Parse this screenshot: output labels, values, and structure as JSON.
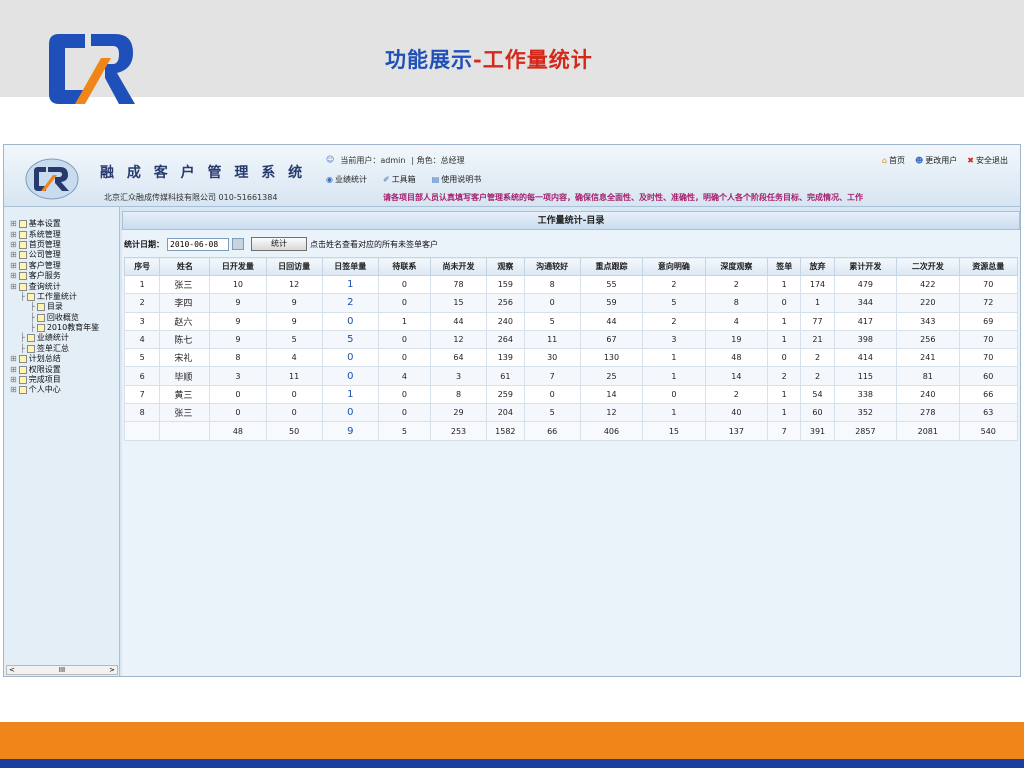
{
  "slide": {
    "title_prefix": "功能展示",
    "title_dash": "-",
    "title_accent": "工作量统计"
  },
  "app": {
    "name": "融 成 客 户 管 理 系 统",
    "company": "北京汇众融成传媒科技有限公司  010-51661384",
    "current_user_label": "当前用户：admin",
    "role_label": "| 角色：总经理",
    "toolbar": [
      "业绩统计",
      "工具箱",
      "使用说明书"
    ],
    "top_links": [
      "首页",
      "更改用户",
      "安全退出"
    ],
    "marquee": "请各项目部人员认真填写客户管理系统的每一项内容，确保信息全面性、及时性、准确性，明确个人各个阶段任务目标、完成情况、工作"
  },
  "sidebar": {
    "items": [
      {
        "label": "基本设置",
        "indent": 0
      },
      {
        "label": "系统管理",
        "indent": 0
      },
      {
        "label": "首页管理",
        "indent": 0
      },
      {
        "label": "公司管理",
        "indent": 0
      },
      {
        "label": "客户管理",
        "indent": 0
      },
      {
        "label": "客户服务",
        "indent": 0
      },
      {
        "label": "查询统计",
        "indent": 0
      },
      {
        "label": "工作量统计",
        "indent": 1
      },
      {
        "label": "目录",
        "indent": 2
      },
      {
        "label": "回收概览",
        "indent": 2
      },
      {
        "label": "2010教育年鉴",
        "indent": 2
      },
      {
        "label": "业绩统计",
        "indent": 1
      },
      {
        "label": "签单汇总",
        "indent": 1
      },
      {
        "label": "计划总结",
        "indent": 0
      },
      {
        "label": "权限设置",
        "indent": 0
      },
      {
        "label": "完成项目",
        "indent": 0
      },
      {
        "label": "个人中心",
        "indent": 0
      }
    ],
    "scroll_left": "<",
    "scroll_mid": "III",
    "scroll_right": ">"
  },
  "main": {
    "panel_title": "工作量统计-目录",
    "filter_label": "统计日期：",
    "date_value": "2010-06-08",
    "stat_button": "统计",
    "hint": "点击姓名查看对应的所有未签单客户",
    "columns": [
      "序号",
      "姓名",
      "日开发量",
      "日回访量",
      "日签单量",
      "待联系",
      "尚未开发",
      "观察",
      "沟通较好",
      "重点跟踪",
      "意向明确",
      "深度观察",
      "签单",
      "放弃",
      "累计开发",
      "二次开发",
      "资源总量"
    ],
    "rows": [
      [
        "1",
        "张三",
        "10",
        "12",
        "1",
        "0",
        "78",
        "159",
        "8",
        "55",
        "2",
        "2",
        "1",
        "174",
        "479",
        "422",
        "70"
      ],
      [
        "2",
        "李四",
        "9",
        "9",
        "2",
        "0",
        "15",
        "256",
        "0",
        "59",
        "5",
        "8",
        "0",
        "1",
        "344",
        "220",
        "72"
      ],
      [
        "3",
        "赵六",
        "9",
        "9",
        "0",
        "1",
        "44",
        "240",
        "5",
        "44",
        "2",
        "4",
        "1",
        "77",
        "417",
        "343",
        "69"
      ],
      [
        "4",
        "陈七",
        "9",
        "5",
        "5",
        "0",
        "12",
        "264",
        "11",
        "67",
        "3",
        "19",
        "1",
        "21",
        "398",
        "256",
        "70"
      ],
      [
        "5",
        "宋礼",
        "8",
        "4",
        "0",
        "0",
        "64",
        "139",
        "30",
        "130",
        "1",
        "48",
        "0",
        "2",
        "414",
        "241",
        "70"
      ],
      [
        "6",
        "毕顺",
        "3",
        "11",
        "0",
        "4",
        "3",
        "61",
        "7",
        "25",
        "1",
        "14",
        "2",
        "2",
        "115",
        "81",
        "60"
      ],
      [
        "7",
        "黄三",
        "0",
        "0",
        "1",
        "0",
        "8",
        "259",
        "0",
        "14",
        "0",
        "2",
        "1",
        "54",
        "338",
        "240",
        "66"
      ],
      [
        "8",
        "张三",
        "0",
        "0",
        "0",
        "0",
        "29",
        "204",
        "5",
        "12",
        "1",
        "40",
        "1",
        "60",
        "352",
        "278",
        "63"
      ]
    ],
    "totals": [
      "",
      "",
      "48",
      "50",
      "9",
      "5",
      "253",
      "1582",
      "66",
      "406",
      "15",
      "137",
      "7",
      "391",
      "2857",
      "2081",
      "540"
    ]
  },
  "colors": {
    "title_blue": "#1f4fb8",
    "title_red": "#d4281a",
    "bar_orange": "#f08619",
    "bar_blue": "#1a3f9e",
    "marquee": "#a5206a"
  }
}
